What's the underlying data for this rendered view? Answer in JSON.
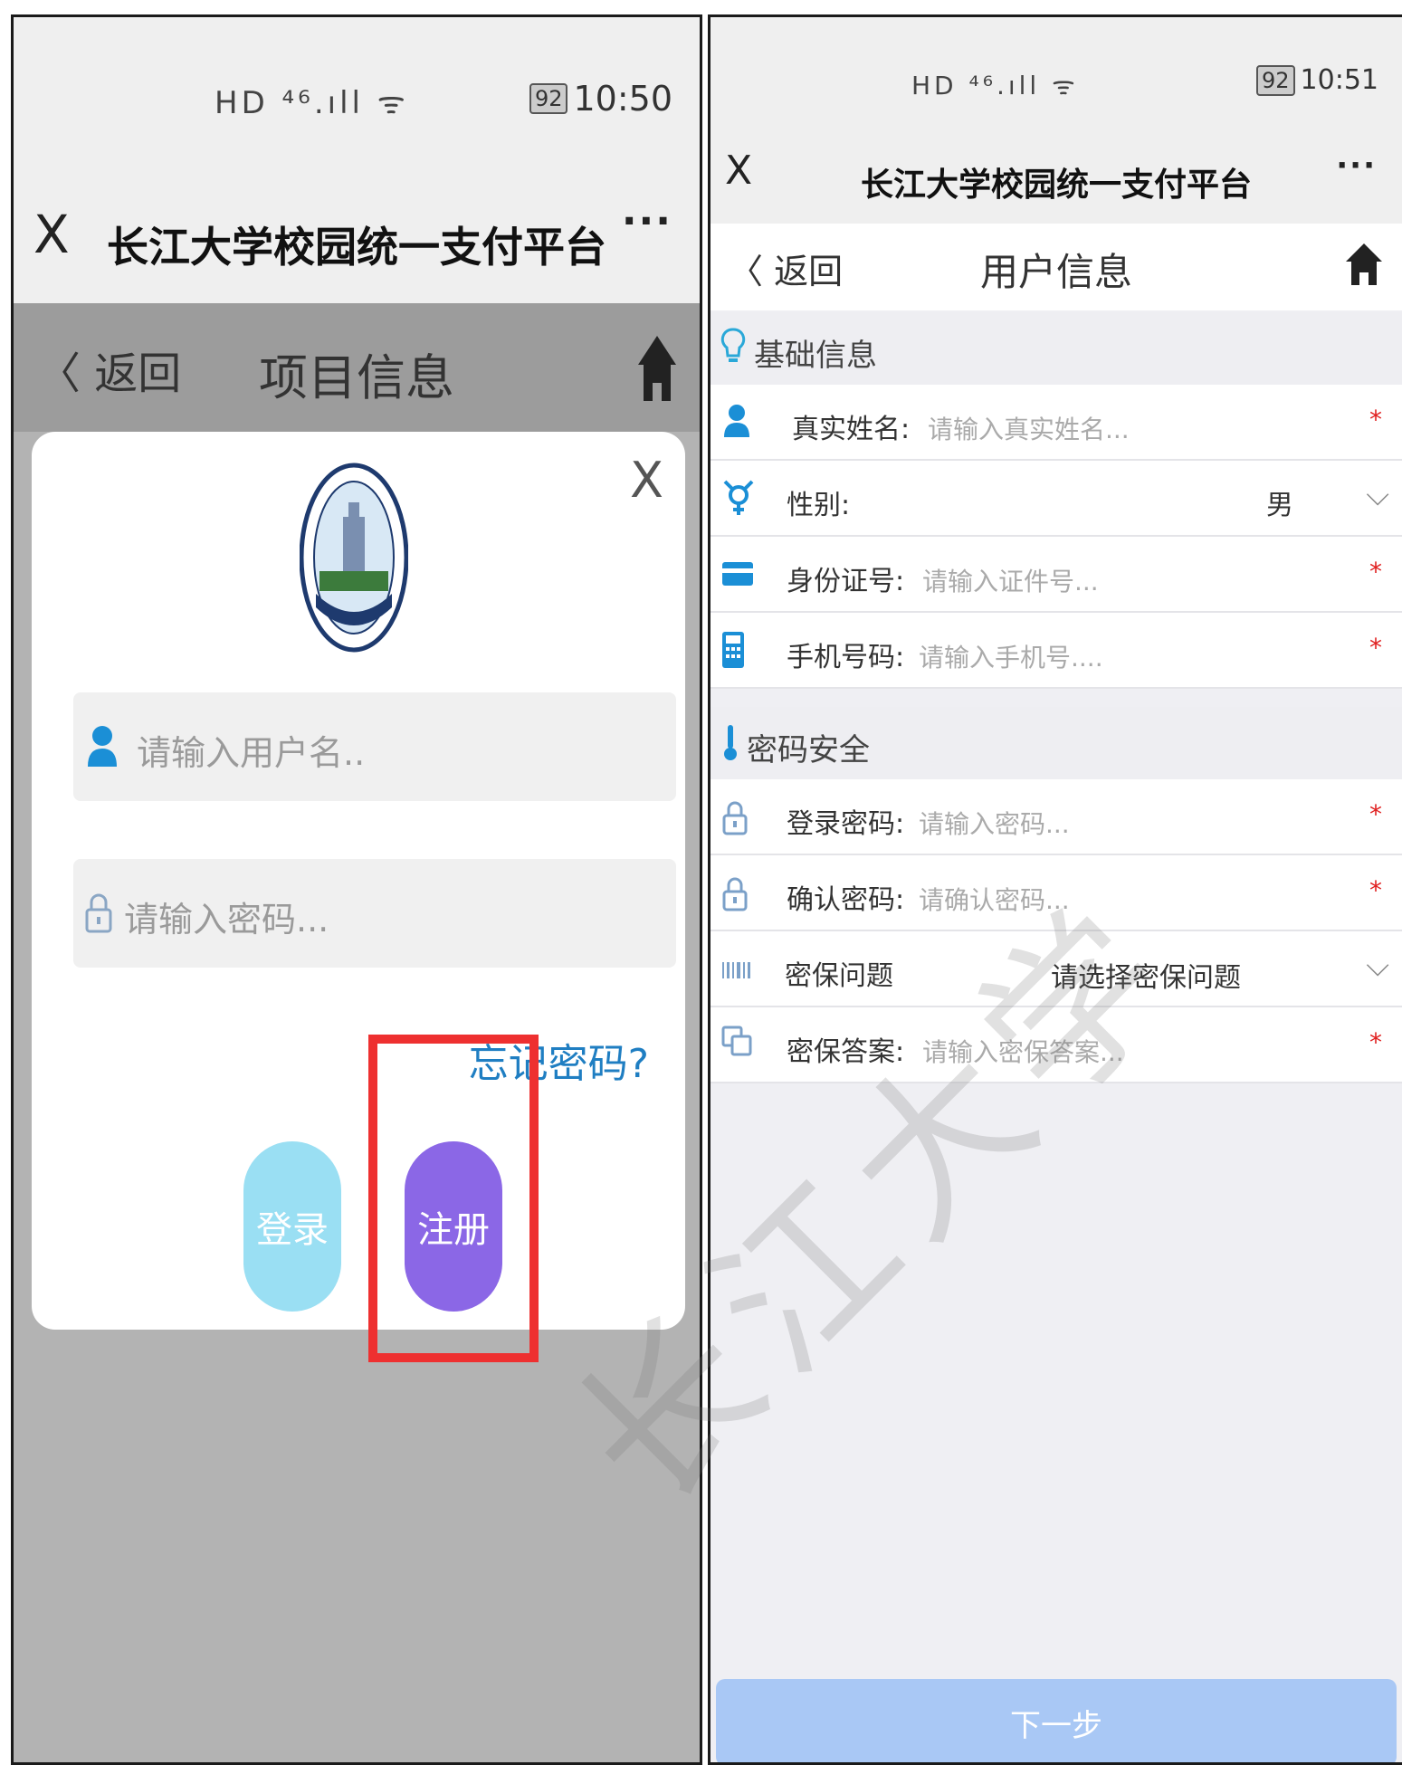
{
  "left": {
    "status": {
      "signal": "HD ⁴⁶.ıll ᯤ",
      "battery": "92",
      "time": "10:50"
    },
    "appbar": {
      "close": "X",
      "title": "长江大学校园统一支付平台",
      "more": "···"
    },
    "navbar": {
      "back": "〈 返回",
      "title": "项目信息"
    },
    "modal": {
      "close": "X",
      "username_placeholder": "请输入用户名..",
      "password_placeholder": "请输入密码...",
      "forgot": "忘记密码?",
      "login_label": "登录",
      "register_label": "注册"
    }
  },
  "right": {
    "status": {
      "signal": "HD ⁴⁶.ıll ᯤ",
      "battery": "92",
      "time": "10:51"
    },
    "appbar": {
      "close": "X",
      "title": "长江大学校园统一支付平台",
      "more": "···"
    },
    "navbar": {
      "back": "〈 返回",
      "title": "用户信息"
    },
    "section_basic": "基础信息",
    "name": {
      "label": "真实姓名:",
      "placeholder": "请输入真实姓名...",
      "required": "*"
    },
    "gender": {
      "label": "性别:",
      "value": "男"
    },
    "idcard": {
      "label": "身份证号:",
      "placeholder": "请输入证件号...",
      "required": "*"
    },
    "phone": {
      "label": "手机号码:",
      "placeholder": "请输入手机号....",
      "required": "*"
    },
    "section_security": "密码安全",
    "password": {
      "label": "登录密码:",
      "placeholder": "请输入密码...",
      "required": "*"
    },
    "confirm": {
      "label": "确认密码:",
      "placeholder": "请确认密码...",
      "required": "*"
    },
    "question": {
      "label": "密保问题",
      "value": "请选择密保问题"
    },
    "answer": {
      "label": "密保答案:",
      "placeholder": "请输入密保答案...",
      "required": "*"
    },
    "next": "下一步"
  },
  "watermark": "长江大学"
}
